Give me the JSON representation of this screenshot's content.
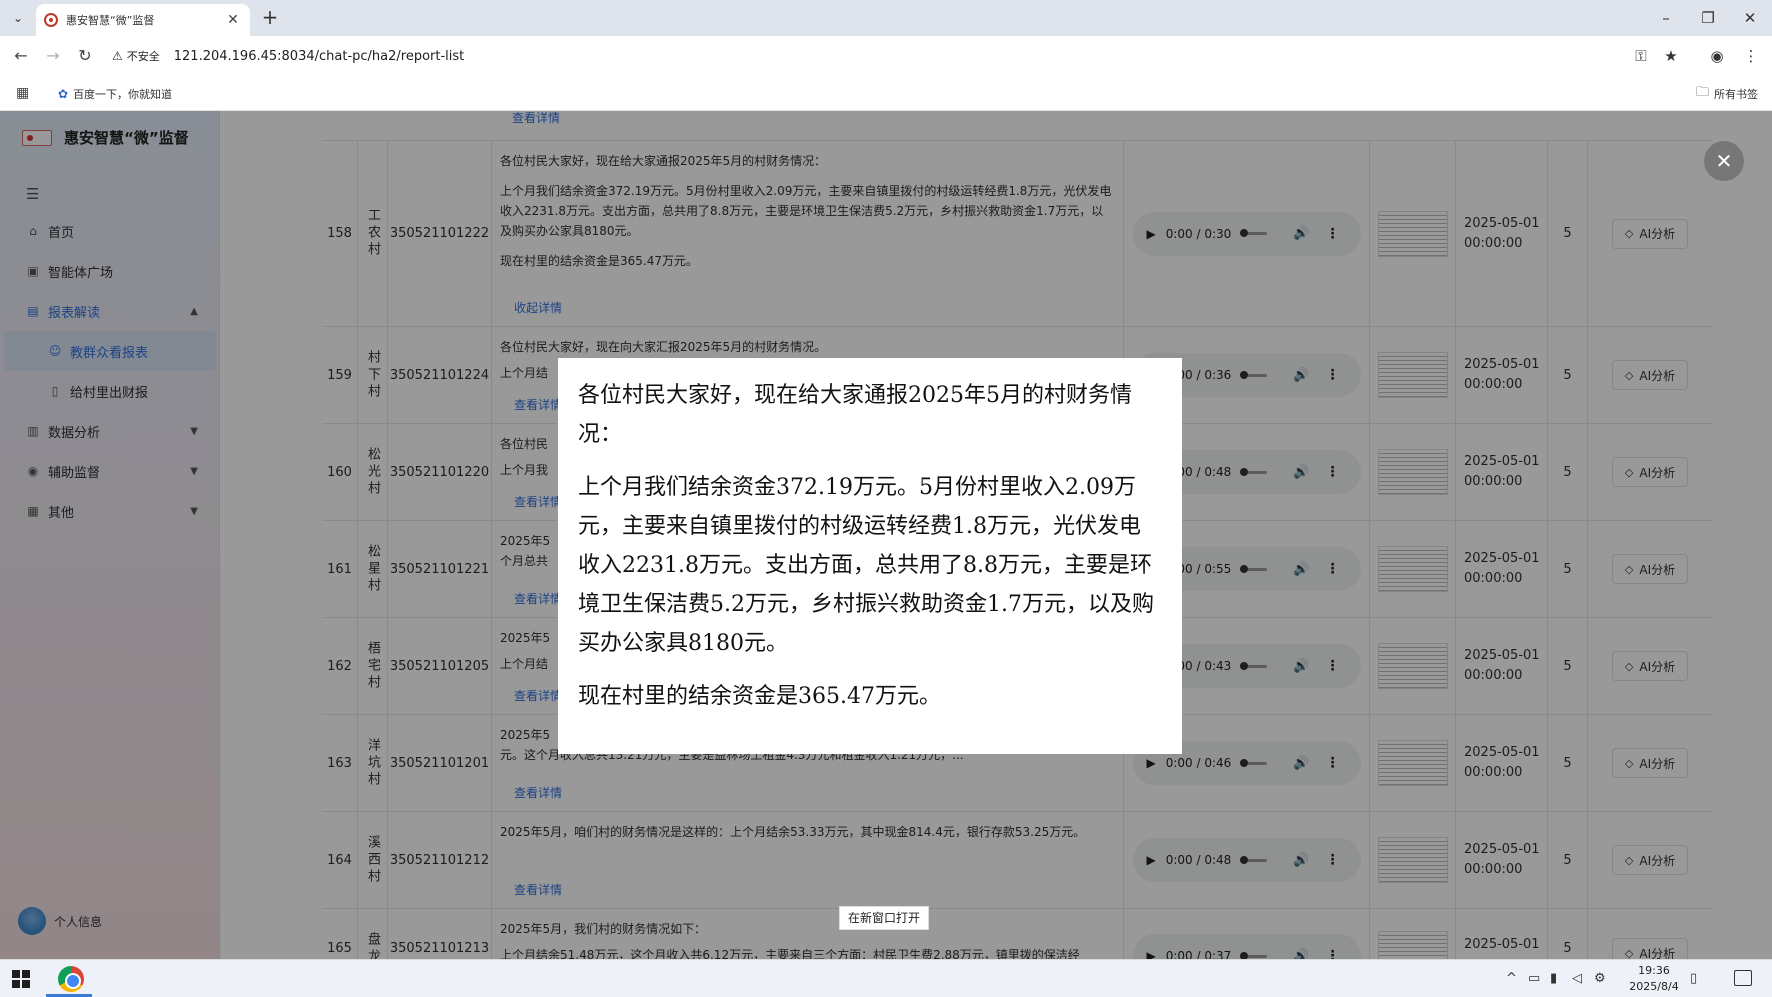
{
  "browser": {
    "tab_title": "惠安智慧“微”监督",
    "new_tab": "+",
    "insecure_label": "不安全",
    "url": "121.204.196.45:8034/chat-pc/ha2/report-list",
    "bookmark_label": "百度一下，你就知道",
    "all_bookmarks": "所有书签"
  },
  "sidebar": {
    "app_name": "惠安智慧“微”监督",
    "menu": [
      {
        "label": "首页"
      },
      {
        "label": "智能体广场"
      },
      {
        "label": "报表解读"
      },
      {
        "label": "教群众看报表"
      },
      {
        "label": "给村里出财报"
      },
      {
        "label": "数据分析"
      },
      {
        "label": "辅助监督"
      },
      {
        "label": "其他"
      }
    ],
    "profile": "个人信息"
  },
  "table": {
    "top_link": "查看详情",
    "ai_button": "AI分析",
    "rows": [
      {
        "no": "158",
        "village": "工农村",
        "code": "350521101222",
        "content": [
          "各位村民大家好，现在给大家通报2025年5月的村财务情况：",
          "上个月我们结余资金372.19万元。5月份村里收入2.09万元，主要来自镇里拨付的村级运转经费1.8万元，光伏发电收入2231.8万元。支出方面，总共用了8.8万元，主要是环境卫生保洁费5.2万元，乡村振兴救助资金1.7万元，以及购买办公家具8180元。",
          "现在村里的结余资金是365.47万元。"
        ],
        "link": "收起详情",
        "audio": "0:00 / 0:30",
        "date1": "2025-05-01",
        "date2": "00:00:00",
        "count": "5"
      },
      {
        "no": "159",
        "village": "村下村",
        "code": "350521101224",
        "content": [
          "各位村民大家好，现在向大家汇报2025年5月的村财务情况。",
          "上个月结"
        ],
        "link": "查看详情",
        "audio": "0:00 / 0:36",
        "date1": "2025-05-01",
        "date2": "00:00:00",
        "count": "5"
      },
      {
        "no": "160",
        "village": "松光村",
        "code": "350521101220",
        "content": [
          "各位村民",
          "上个月我"
        ],
        "link": "查看详情",
        "audio": "0:00 / 0:48",
        "date1": "2025-05-01",
        "date2": "00:00:00",
        "count": "5"
      },
      {
        "no": "161",
        "village": "松星村",
        "code": "350521101221",
        "content": [
          "2025年5",
          "个月总共"
        ],
        "link": "查看详情",
        "audio": "0:00 / 0:55",
        "date1": "2025-05-01",
        "date2": "00:00:00",
        "count": "5"
      },
      {
        "no": "162",
        "village": "梧宅村",
        "code": "350521101205",
        "content": [
          "2025年5",
          "上个月结"
        ],
        "link": "查看详情",
        "audio": "0:00 / 0:43",
        "date1": "2025-05-01",
        "date2": "00:00:00",
        "count": "5"
      },
      {
        "no": "163",
        "village": "洋坑村",
        "code": "350521101201",
        "content": [
          "2025年5",
          "元。这个月收入总共13.21万元，主要是益林场土租金4.3万元和租金收入1.21万元，..."
        ],
        "link": "查看详情",
        "audio": "0:00 / 0:46",
        "date1": "2025-05-01",
        "date2": "00:00:00",
        "count": "5"
      },
      {
        "no": "164",
        "village": "溪西村",
        "code": "350521101212",
        "content": [
          "2025年5月，咱们村的财务情况是这样的：上个月结余53.33万元，其中现金814.4元，银行存款53.25万元。"
        ],
        "link": "查看详情",
        "audio": "0:00 / 0:48",
        "date1": "2025-05-01",
        "date2": "00:00:00",
        "count": "5"
      },
      {
        "no": "165",
        "village": "盘龙村",
        "code": "350521101213",
        "content": [
          "2025年5月，我们村的财务情况如下：",
          "上个月结余51.48万元，这个月收入共6.12万元，主要来自三个方面：村民卫生费2.88万元，镇里拨的保洁经"
        ],
        "link": "",
        "audio": "0:00 / 0:37",
        "date1": "2025-05-01",
        "date2": "",
        "count": "5"
      }
    ]
  },
  "preview": {
    "paragraphs": [
      "各位村民大家好，现在给大家通报2025年5月的村财务情况：",
      "上个月我们结余资金372.19万元。5月份村里收入2.09万元，主要来自镇里拨付的村级运转经费1.8万元，光伏发电收入2231.8万元。支出方面，总共用了8.8万元，主要是环境卫生保洁费5.2万元，乡村振兴救助资金1.7万元，以及购买办公家具8180元。",
      "现在村里的结余资金是365.47万元。"
    ],
    "open_new_window": "在新窗口打开"
  },
  "taskbar": {
    "time": "19:36",
    "date": "2025/8/4"
  }
}
